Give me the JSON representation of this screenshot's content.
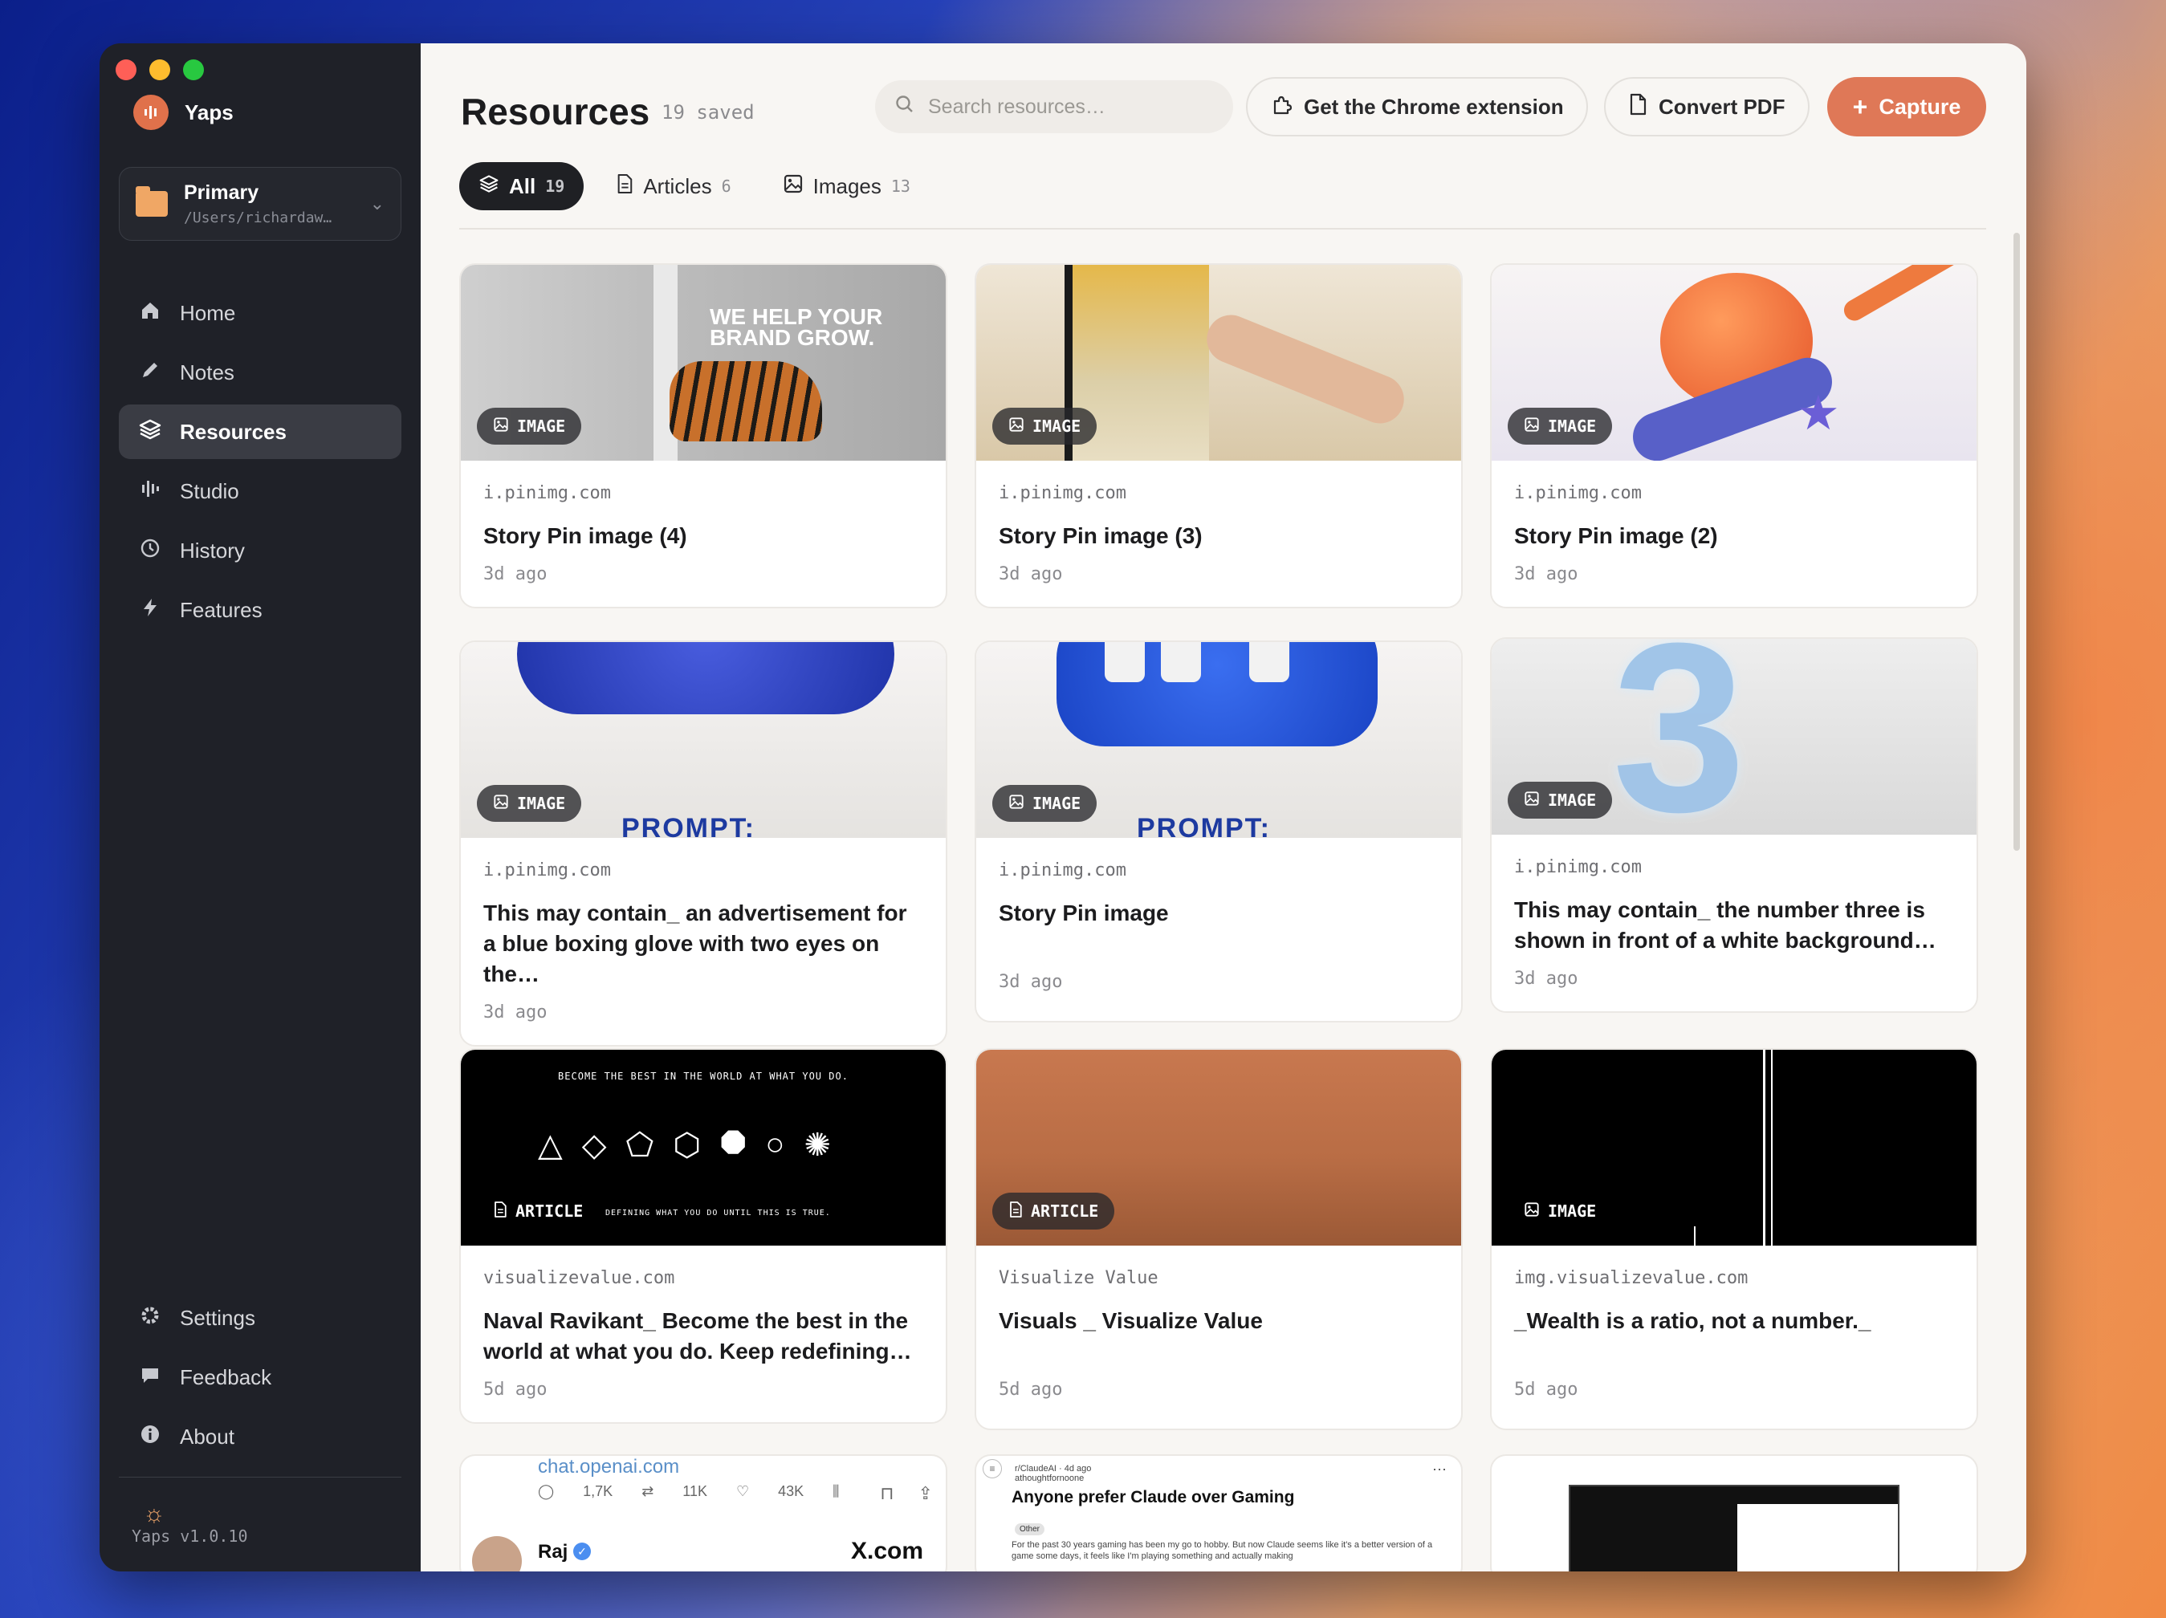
{
  "app": {
    "name": "Yaps",
    "version": "Yaps v1.0.10"
  },
  "workspace": {
    "name": "Primary",
    "path": "/Users/richardaw…"
  },
  "nav": {
    "items": [
      {
        "label": "Home",
        "icon": "home-icon"
      },
      {
        "label": "Notes",
        "icon": "pencil-icon"
      },
      {
        "label": "Resources",
        "icon": "layers-icon",
        "active": true
      },
      {
        "label": "Studio",
        "icon": "waveform-icon"
      },
      {
        "label": "History",
        "icon": "clock-icon"
      },
      {
        "label": "Features",
        "icon": "bolt-icon"
      }
    ],
    "bottom": [
      {
        "label": "Settings",
        "icon": "gear-icon"
      },
      {
        "label": "Feedback",
        "icon": "chat-icon"
      },
      {
        "label": "About",
        "icon": "info-icon"
      }
    ]
  },
  "header": {
    "title": "Resources",
    "saved": "19  saved",
    "search_placeholder": "Search resources…",
    "chrome_label": "Get the Chrome extension",
    "pdf_label": "Convert PDF",
    "capture_label": "Capture"
  },
  "filters": [
    {
      "label": "All",
      "count": "19",
      "active": true
    },
    {
      "label": "Articles",
      "count": "6"
    },
    {
      "label": "Images",
      "count": "13"
    }
  ],
  "cards": [
    {
      "type": "IMAGE",
      "domain": "i.pinimg.com",
      "title": "Story Pin image (4)",
      "time": "3d  ago",
      "slogan": "WE HELP YOUR BRAND GROW."
    },
    {
      "type": "IMAGE",
      "domain": "i.pinimg.com",
      "title": "Story Pin image (3)",
      "time": "3d  ago"
    },
    {
      "type": "IMAGE",
      "domain": "i.pinimg.com",
      "title": "Story Pin image (2)",
      "time": "3d  ago"
    },
    {
      "type": "IMAGE",
      "domain": "i.pinimg.com",
      "title": "This may contain_ an advertisement for a blue boxing glove with two eyes on the…",
      "time": "3d  ago",
      "overlay": "PROMPT:"
    },
    {
      "type": "IMAGE",
      "domain": "i.pinimg.com",
      "title": "Story Pin image",
      "time": "3d  ago",
      "overlay": "PROMPT:"
    },
    {
      "type": "IMAGE",
      "domain": "i.pinimg.com",
      "title": "This may contain_ the number three is shown in front of a white background…",
      "time": "3d  ago",
      "overlay": "3"
    },
    {
      "type": "ARTICLE",
      "domain": "visualizevalue.com",
      "title": "Naval Ravikant_ Become the best in the world at what you do. Keep redefining…",
      "time": "5d  ago",
      "tagline": "BECOME THE BEST IN THE WORLD AT WHAT YOU DO.",
      "subline": "DEFINING WHAT YOU DO UNTIL THIS IS TRUE."
    },
    {
      "type": "ARTICLE",
      "domain": "Visualize Value",
      "title": "Visuals _ Visualize Value",
      "time": "5d  ago"
    },
    {
      "type": "IMAGE",
      "domain": "img.visualizevalue.com",
      "title": "_Wealth is a ratio, not a number._",
      "time": "5d  ago"
    }
  ],
  "partial": {
    "tweet": {
      "domain": "chat.openai.com",
      "replies": "1,7K",
      "retweets": "11K",
      "likes": "43K",
      "name": "Raj",
      "source": "X.com"
    },
    "reddit": {
      "sub": "r/ClaudeAI · 4d ago",
      "user": "athoughtfornoone",
      "title": "Anyone prefer Claude over Gaming",
      "tag": "Other",
      "body": "For the past 30 years gaming has been my go to hobby. But now Claude seems like it's a better version of a game some days, it feels like I'm playing something and actually making"
    }
  }
}
